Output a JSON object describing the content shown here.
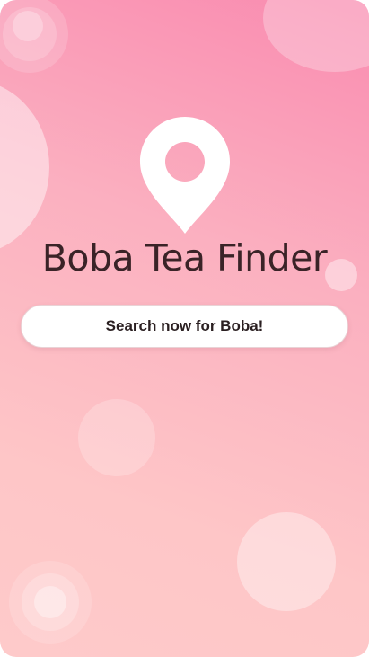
{
  "app": {
    "title": "Boba Tea Finder"
  },
  "actions": {
    "search_label": "Search now for Boba!"
  },
  "icons": {
    "hero": "location-pin-icon"
  },
  "colors": {
    "background_top": "#f98bb0",
    "background_bottom": "#fecaca",
    "title_text": "#3a2327",
    "button_background": "#ffffff",
    "button_text": "#2a1f21"
  }
}
